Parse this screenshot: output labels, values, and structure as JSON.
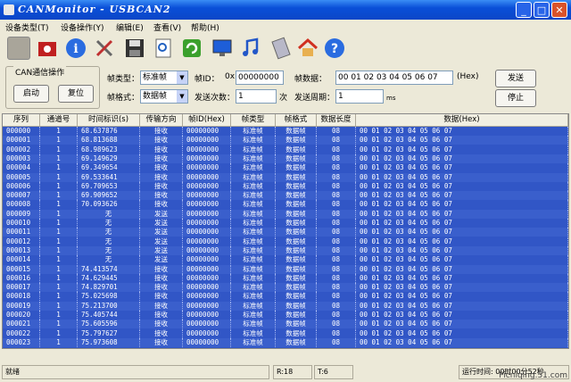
{
  "window": {
    "title": "CANMonitor - USBCAN2",
    "min_label": "_",
    "max_label": "□",
    "close_label": "✕"
  },
  "menu": [
    "设备类型(T)",
    "设备操作(Y)",
    "编辑(E)",
    "查看(V)",
    "帮助(H)"
  ],
  "toolbar": {
    "icons": [
      "stop-icon",
      "record-icon",
      "info-icon",
      "tools-icon",
      "save-icon",
      "preview-icon",
      "refresh-icon",
      "monitor-icon",
      "music-icon",
      "calculator-icon",
      "home-icon",
      "help-icon"
    ]
  },
  "controls": {
    "group_title": "CAN通信操作",
    "start_label": "启动",
    "reset_label": "复位",
    "frame_type_label": "帧类型：",
    "frame_type_value": "标准帧",
    "frame_format_label": "帧格式：",
    "frame_format_value": "数据帧",
    "frame_id_label": "帧ID：",
    "frame_id_prefix": "0x",
    "frame_id_value": "00000000",
    "send_count_label": "发送次数：",
    "send_count_value": "1",
    "send_count_unit": "次",
    "data_label": "帧数据：",
    "data_value": "00 01 02 03 04 05 06 07",
    "data_hex": "(Hex)",
    "period_label": "发送周期：",
    "period_value": "1",
    "period_unit": "ms",
    "send_label": "发送",
    "stop_label": "停止"
  },
  "table": {
    "headers": [
      "序列",
      "通道号",
      "时间标识(s)",
      "传输方向",
      "帧ID(Hex)",
      "帧类型",
      "帧格式",
      "数据长度",
      "数据(Hex)"
    ],
    "rows": [
      [
        "000000",
        "1",
        "68.637876",
        "接收",
        "00000000",
        "标准帧",
        "数据帧",
        "08",
        "00 01 02 03 04 05 06 07"
      ],
      [
        "000001",
        "1",
        "68.813688",
        "接收",
        "00000000",
        "标准帧",
        "数据帧",
        "08",
        "00 01 02 03 04 05 06 07"
      ],
      [
        "000002",
        "1",
        "68.989623",
        "接收",
        "00000000",
        "标准帧",
        "数据帧",
        "08",
        "00 01 02 03 04 05 06 07"
      ],
      [
        "000003",
        "1",
        "69.149629",
        "接收",
        "00000000",
        "标准帧",
        "数据帧",
        "08",
        "00 01 02 03 04 05 06 07"
      ],
      [
        "000004",
        "1",
        "69.349654",
        "接收",
        "00000000",
        "标准帧",
        "数据帧",
        "08",
        "00 01 02 03 04 05 06 07"
      ],
      [
        "000005",
        "1",
        "69.533641",
        "接收",
        "00000000",
        "标准帧",
        "数据帧",
        "08",
        "00 01 02 03 04 05 06 07"
      ],
      [
        "000006",
        "1",
        "69.709653",
        "接收",
        "00000000",
        "标准帧",
        "数据帧",
        "08",
        "00 01 02 03 04 05 06 07"
      ],
      [
        "000007",
        "1",
        "69.909652",
        "接收",
        "00000000",
        "标准帧",
        "数据帧",
        "08",
        "00 01 02 03 04 05 06 07"
      ],
      [
        "000008",
        "1",
        "70.093626",
        "接收",
        "00000000",
        "标准帧",
        "数据帧",
        "08",
        "00 01 02 03 04 05 06 07"
      ],
      [
        "000009",
        "1",
        "无",
        "发送",
        "00000000",
        "标准帧",
        "数据帧",
        "08",
        "00 01 02 03 04 05 06 07"
      ],
      [
        "000010",
        "1",
        "无",
        "发送",
        "00000000",
        "标准帧",
        "数据帧",
        "08",
        "00 01 02 03 04 05 06 07"
      ],
      [
        "000011",
        "1",
        "无",
        "发送",
        "00000000",
        "标准帧",
        "数据帧",
        "08",
        "00 01 02 03 04 05 06 07"
      ],
      [
        "000012",
        "1",
        "无",
        "发送",
        "00000000",
        "标准帧",
        "数据帧",
        "08",
        "00 01 02 03 04 05 06 07"
      ],
      [
        "000013",
        "1",
        "无",
        "发送",
        "00000000",
        "标准帧",
        "数据帧",
        "08",
        "00 01 02 03 04 05 06 07"
      ],
      [
        "000014",
        "1",
        "无",
        "发送",
        "00000000",
        "标准帧",
        "数据帧",
        "08",
        "00 01 02 03 04 05 06 07"
      ],
      [
        "000015",
        "1",
        "74.413574",
        "接收",
        "00000000",
        "标准帧",
        "数据帧",
        "08",
        "00 01 02 03 04 05 06 07"
      ],
      [
        "000016",
        "1",
        "74.629445",
        "接收",
        "00000000",
        "标准帧",
        "数据帧",
        "08",
        "00 01 02 03 04 05 06 07"
      ],
      [
        "000017",
        "1",
        "74.829701",
        "接收",
        "00000000",
        "标准帧",
        "数据帧",
        "08",
        "00 01 02 03 04 05 06 07"
      ],
      [
        "000018",
        "1",
        "75.025698",
        "接收",
        "00000000",
        "标准帧",
        "数据帧",
        "08",
        "00 01 02 03 04 05 06 07"
      ],
      [
        "000019",
        "1",
        "75.213700",
        "接收",
        "00000000",
        "标准帧",
        "数据帧",
        "08",
        "00 01 02 03 04 05 06 07"
      ],
      [
        "000020",
        "1",
        "75.405744",
        "接收",
        "00000000",
        "标准帧",
        "数据帧",
        "08",
        "00 01 02 03 04 05 06 07"
      ],
      [
        "000021",
        "1",
        "75.605596",
        "接收",
        "00000000",
        "标准帧",
        "数据帧",
        "08",
        "00 01 02 03 04 05 06 07"
      ],
      [
        "000022",
        "1",
        "75.797627",
        "接收",
        "00000000",
        "标准帧",
        "数据帧",
        "08",
        "00 01 02 03 04 05 06 07"
      ],
      [
        "000023",
        "1",
        "75.973608",
        "接收",
        "00000000",
        "标准帧",
        "数据帧",
        "08",
        "00 01 02 03 04 05 06 07"
      ]
    ]
  },
  "status": {
    "ready": "就绪",
    "r": "R:18",
    "t": "T:6",
    "runtime": "运行时间: 00时00分52秒"
  },
  "watermark": "Picniqing.51.com",
  "colors": {
    "selection": "#3156C6",
    "titlebar": "#0A4FD8"
  }
}
